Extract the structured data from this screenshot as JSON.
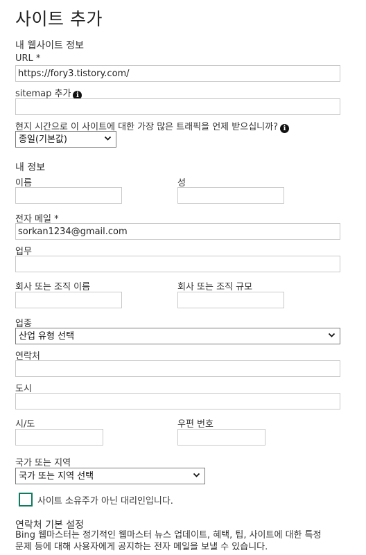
{
  "page_title": "사이트 추가",
  "my_site": {
    "section": "내 웹사이트 정보",
    "url_label": "URL *",
    "url_value": "https://fory3.tistory.com/",
    "sitemap_label": "sitemap 추가",
    "traffic_question": "현지 시간으로 이 사이트에 대한 가장 많은 트래픽을 언제 받으십니까?",
    "traffic_selected": "종일(기본값)"
  },
  "my_info": {
    "section": "내 정보",
    "first_name_label": "이름",
    "last_name_label": "성",
    "email_label": "전자 메일 *",
    "email_value": "sorkan1234@gmail.com",
    "job_label": "업무",
    "company_label": "회사 또는 조직 이름",
    "company_size_label": "회사 또는 조직 규모",
    "industry_label": "업종",
    "industry_selected": "산업 유형 선택",
    "contact_label": "연락처",
    "city_label": "도시",
    "state_label": "시/도",
    "postal_label": "우편 번호",
    "country_label": "국가 또는 지역",
    "country_selected": "국가 또는 지역 선택",
    "agent_checkbox_label": "사이트 소유주가 아닌 대리인입니다."
  },
  "contact_prefs": {
    "section": "연락처 기본 설정",
    "line1": "Bing 웹마스터는 정기적인 웹마스터 뉴스 업데이트, 혜택, 팁, 사이트에 대한 특정",
    "line2": "문제 등에 대해 사용자에게 공지하는 전자 메일을 보낼 수 있습니다."
  },
  "colors": {
    "checkbox_border": "#0e7a5f",
    "input_border": "#c8c8c8"
  },
  "icons": [
    "info-icon",
    "chevron-down-icon"
  ]
}
